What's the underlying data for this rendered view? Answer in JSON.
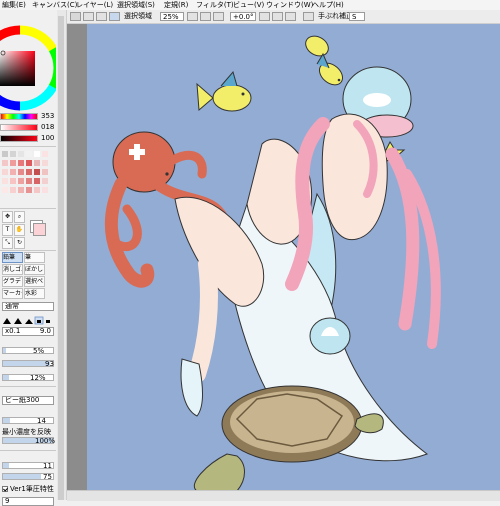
{
  "menu": [
    "編集(E)",
    "キャンバス(C)",
    "レイヤー(L)",
    "選択領域(S)",
    "定規(R)",
    "フィルタ(T)",
    "ビュー(V)",
    "ウィンドウ(W)",
    "ヘルプ(H)"
  ],
  "toolbar": {
    "selection_label": "選択領域",
    "zoom": "25%",
    "rotation": "+0.0°",
    "stabilizer_label": "手ぶれ補正",
    "stabilizer_value": "S"
  },
  "color": {
    "h": "353",
    "s": "018",
    "v": "100",
    "current": "#ff0016",
    "secondary": "#fbd3d6"
  },
  "swatches": [
    [
      "#c9c9c9",
      "#d4d4d4",
      "#e5e5e5",
      "#f2f2f2",
      "#ffffff",
      "#fbe3e3"
    ],
    [
      "#f3c7c7",
      "#ee9c9c",
      "#e7797b",
      "#de5a5c",
      "#e8b6b6",
      "#f6dada"
    ],
    [
      "#f9d6d6",
      "#f2b0b0",
      "#e68b8b",
      "#d96a6a",
      "#c44f4f",
      "#f0c2c2"
    ],
    [
      "#fbe0e0",
      "#f7c3c3",
      "#eda1a1",
      "#e28080",
      "#d86565",
      "#f3cfcf"
    ],
    [
      "#fde8e8",
      "#f8d0d0",
      "#f1b2b2",
      "#e89393",
      "#f4c6c6",
      "#fae0e0"
    ]
  ],
  "tools": {
    "brushes": [
      "鉛筆",
      "筆",
      "消しゴム",
      "ぼかし",
      "グラデ",
      "選択ペン",
      "マーカー",
      "水彩"
    ],
    "blend_mode": "通常"
  },
  "brush_settings": {
    "size_multiplier": "x0.1",
    "size": "9.0",
    "min_size": "5%",
    "density": "93",
    "blur": "12%",
    "texture": "ビー紙300",
    "texture_value": "14",
    "min_density_label": "最小濃度を反映",
    "min_density_value": "100%",
    "blending": "11",
    "dilution": "75",
    "ver1_label": "Ver1筆圧特性",
    "ver1_checked": true,
    "last_value": "9"
  }
}
